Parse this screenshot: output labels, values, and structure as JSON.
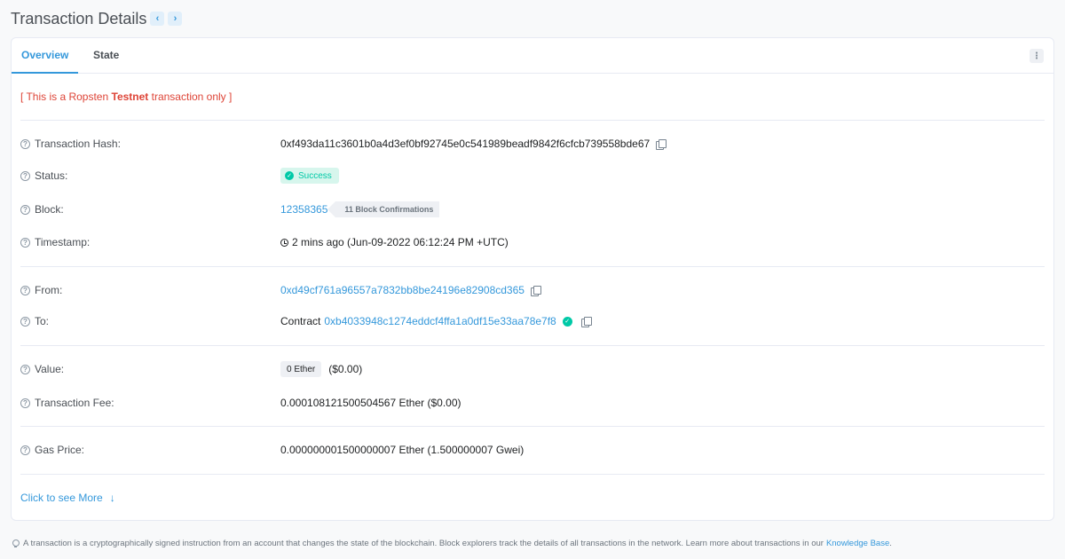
{
  "header": {
    "title": "Transaction Details",
    "prev": "‹",
    "next": "›"
  },
  "tabs": [
    {
      "label": "Overview"
    },
    {
      "label": "State"
    }
  ],
  "more_menu": "⋮",
  "notice": {
    "prefix": "[ This is a Ropsten ",
    "bold": "Testnet",
    "suffix": " transaction only ]"
  },
  "rows": {
    "hash": {
      "label": "Transaction Hash:",
      "value": "0xf493da11c3601b0a4d3ef0bf92745e0c541989beadf9842f6cfcb739558bde67"
    },
    "status": {
      "label": "Status:",
      "value": "Success"
    },
    "block": {
      "label": "Block:",
      "value": "12358365",
      "confirmations": "11 Block Confirmations"
    },
    "timestamp": {
      "label": "Timestamp:",
      "value": "2 mins ago (Jun-09-2022 06:12:24 PM +UTC)"
    },
    "from": {
      "label": "From:",
      "value": "0xd49cf761a96557a7832bb8be24196e82908cd365"
    },
    "to": {
      "label": "To:",
      "prefix": "Contract",
      "value": "0xb4033948c1274eddcf4ffa1a0df15e33aa78e7f8"
    },
    "value": {
      "label": "Value:",
      "badge": "0 Ether",
      "usd": "($0.00)"
    },
    "fee": {
      "label": "Transaction Fee:",
      "value": "0.000108121500504567 Ether ($0.00)"
    },
    "gas": {
      "label": "Gas Price:",
      "value": "0.000000001500000007 Ether (1.500000007 Gwei)"
    }
  },
  "see_more": {
    "label": "Click to see More",
    "arrow": "↓"
  },
  "footer": {
    "text": "A transaction is a cryptographically signed instruction from an account that changes the state of the blockchain. Block explorers track the details of all transactions in the network. Learn more about transactions in our ",
    "link": "Knowledge Base",
    "end": "."
  },
  "colors": {
    "accent": "#3498db",
    "success": "#00c9a7",
    "danger": "#de4437"
  }
}
